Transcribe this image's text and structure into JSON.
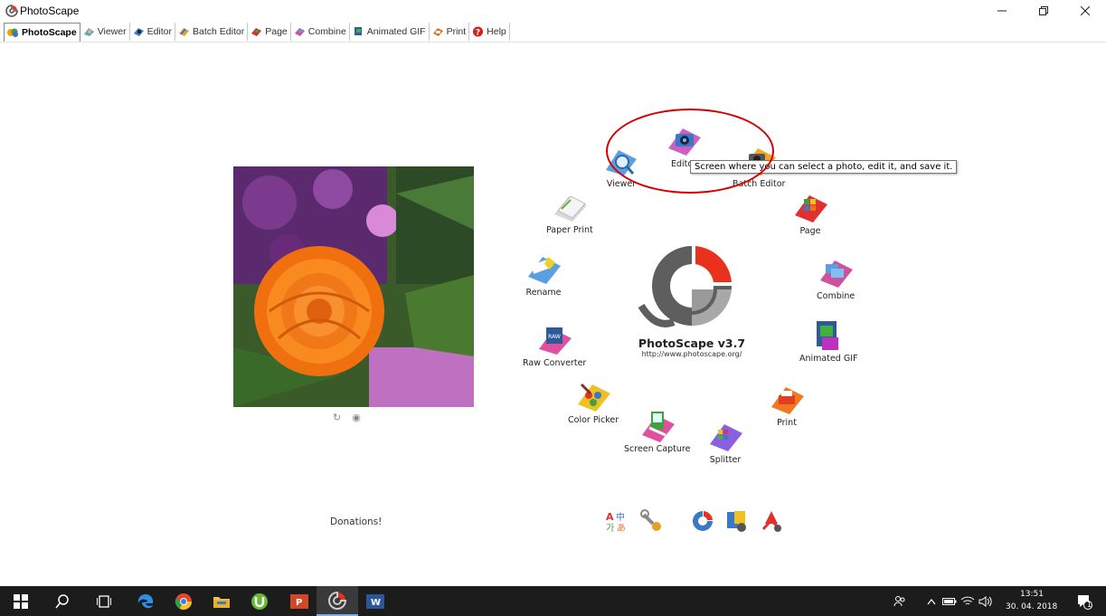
{
  "window": {
    "title": "PhotoScape"
  },
  "tabs": [
    {
      "label": "PhotoScape",
      "icon": "photoscape-icon"
    },
    {
      "label": "Viewer",
      "icon": "viewer-icon"
    },
    {
      "label": "Editor",
      "icon": "editor-icon"
    },
    {
      "label": "Batch Editor",
      "icon": "batch-editor-icon"
    },
    {
      "label": "Page",
      "icon": "page-icon"
    },
    {
      "label": "Combine",
      "icon": "combine-icon"
    },
    {
      "label": "Animated GIF",
      "icon": "animated-gif-icon"
    },
    {
      "label": "Print",
      "icon": "print-icon"
    },
    {
      "label": "Help",
      "icon": "help-icon"
    }
  ],
  "menu": {
    "viewer": "Viewer",
    "editor": "Editor",
    "batch_editor": "Batch Editor",
    "page": "Page",
    "combine": "Combine",
    "animated_gif": "Animated GIF",
    "print": "Print",
    "splitter": "Splitter",
    "screen_capture": "Screen Capture",
    "color_picker": "Color Picker",
    "raw_converter": "Raw Converter",
    "rename": "Rename",
    "paper_print": "Paper Print"
  },
  "logo": {
    "title": "PhotoScape v3.7",
    "url": "http://www.photoscape.org/"
  },
  "tooltip": "Screen where you can select a photo, edit it, and save it.",
  "donations": "Donations!",
  "taskbar": {
    "time": "13:51",
    "date": "30. 04. 2018",
    "notifications": "1"
  },
  "colors": {
    "annotation": "#d40000",
    "taskbar": "#1c1c1c",
    "logo_red": "#e8321e",
    "logo_gray": "#6e6e6e"
  }
}
